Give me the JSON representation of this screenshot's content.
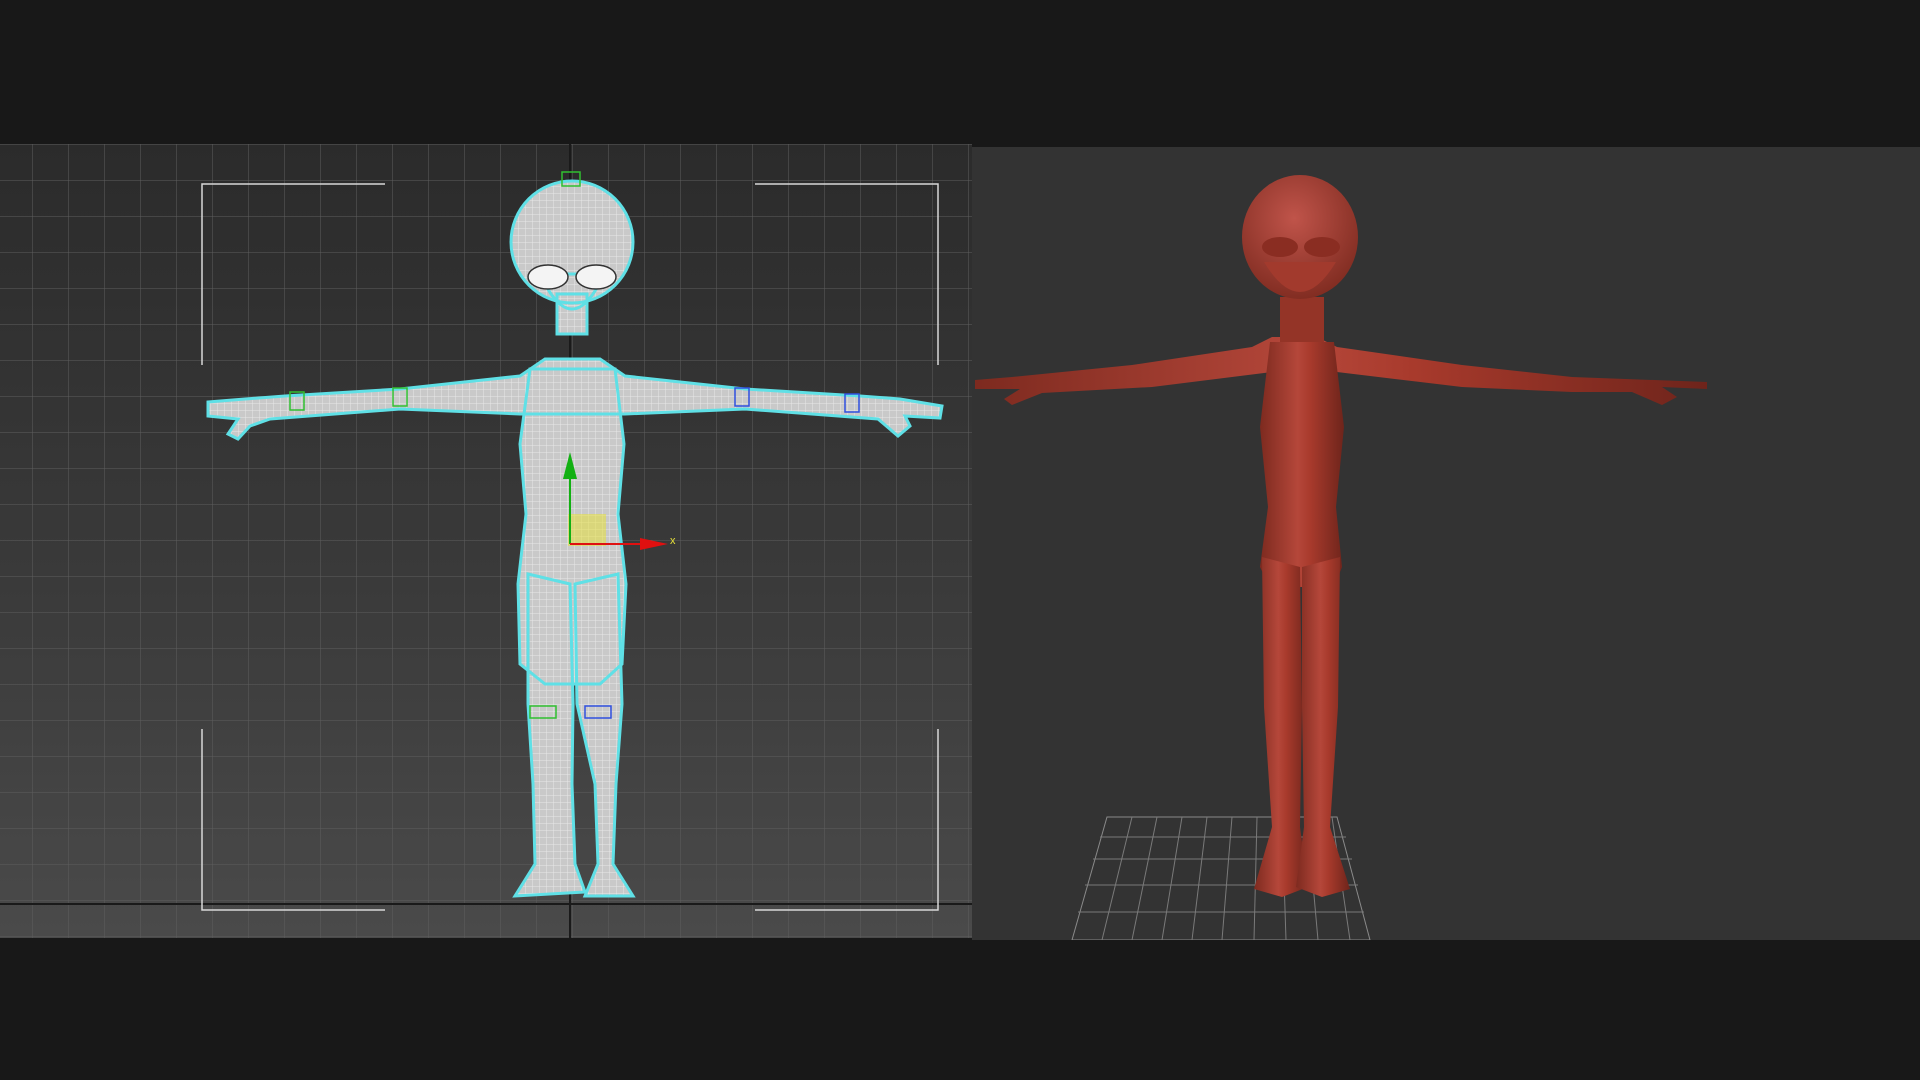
{
  "scene": {
    "left_viewport": {
      "mode": "wireframe",
      "gizmo_axis_label": "x",
      "colors": {
        "background_top": "#2b2b2b",
        "background_bottom": "#4a4a4a",
        "grid": "#5e5e5e",
        "wire": "#e8e8e8",
        "selection_outline": "#5fe0e6",
        "gizmo_x": "#e01010",
        "gizmo_y": "#12b012",
        "pivot_highlight": "#e6e03a",
        "safe_frame": "#d8d8d8"
      }
    },
    "right_viewport": {
      "mode": "shaded-sculpt",
      "colors": {
        "background": "#333333",
        "model": "#a83a2c",
        "floor_grid": "#7a7a7a"
      }
    }
  }
}
